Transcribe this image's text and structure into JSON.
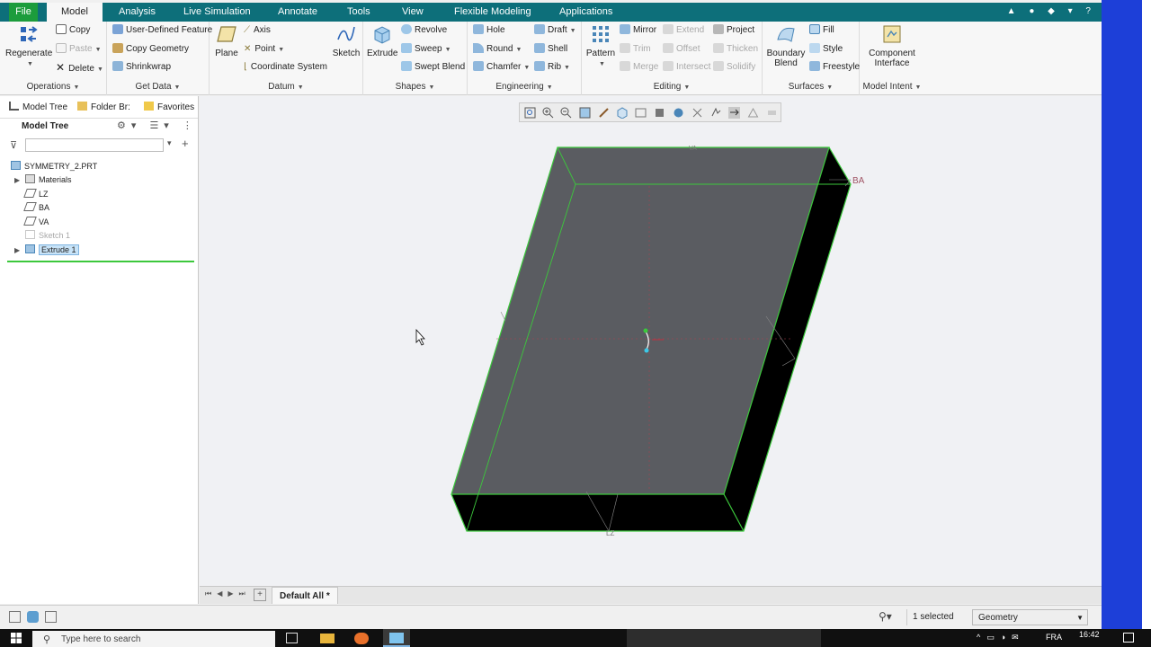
{
  "menu": {
    "tabs": [
      "File",
      "Model",
      "Analysis",
      "Live Simulation",
      "Annotate",
      "Tools",
      "View",
      "Flexible Modeling",
      "Applications"
    ],
    "active": "Model"
  },
  "ribbon": {
    "operations": {
      "regenerate": "Regenerate",
      "copy": "Copy",
      "paste": "Paste",
      "delete": "Delete",
      "label": "Operations"
    },
    "get_data": {
      "udf": "User-Defined Feature",
      "copy_geometry": "Copy Geometry",
      "shrinkwrap": "Shrinkwrap",
      "label": "Get Data"
    },
    "datum": {
      "plane": "Plane",
      "axis": "Axis",
      "point": "Point",
      "csys": "Coordinate System",
      "sketch": "Sketch",
      "label": "Datum"
    },
    "shapes": {
      "extrude": "Extrude",
      "revolve": "Revolve",
      "sweep": "Sweep",
      "swept_blend": "Swept Blend",
      "label": "Shapes"
    },
    "engineering": {
      "hole": "Hole",
      "round": "Round",
      "chamfer": "Chamfer",
      "draft": "Draft",
      "shell": "Shell",
      "rib": "Rib",
      "label": "Engineering"
    },
    "editing": {
      "pattern": "Pattern",
      "mirror": "Mirror",
      "trim": "Trim",
      "merge": "Merge",
      "extend": "Extend",
      "offset": "Offset",
      "intersect": "Intersect",
      "project": "Project",
      "thicken": "Thicken",
      "solidify": "Solidify",
      "label": "Editing"
    },
    "surfaces": {
      "boundary_blend": "Boundary Blend",
      "fill": "Fill",
      "style": "Style",
      "freestyle": "Freestyle",
      "label": "Surfaces"
    },
    "model_intent": {
      "component_interface": "Component Interface",
      "label": "Model Intent"
    }
  },
  "panel": {
    "tabs": [
      "Model Tree",
      "Folder Br:",
      "Favorites"
    ],
    "header": "Model Tree",
    "search_placeholder": "",
    "tree": [
      {
        "label": "SYMMETRY_2.PRT",
        "icon": "part-icon"
      },
      {
        "label": "Materials",
        "icon": "materials-icon"
      },
      {
        "label": "LZ",
        "icon": "datum-plane-icon"
      },
      {
        "label": "BA",
        "icon": "datum-plane-icon"
      },
      {
        "label": "VA",
        "icon": "datum-plane-icon"
      },
      {
        "label": "Sketch 1",
        "icon": "sketch-icon"
      },
      {
        "label": "Extrude 1",
        "icon": "extrude-icon"
      }
    ]
  },
  "viewport": {
    "plane_label_ba": "BA",
    "plane_label_lz": "LZ",
    "plane_label_va": "VA"
  },
  "bottom": {
    "view_tab": "Default All *"
  },
  "status": {
    "selected": "1 selected",
    "filter": "Geometry"
  },
  "taskbar": {
    "search_placeholder": "Type here to search",
    "lang": "FRA",
    "time": "16:42"
  },
  "colors": {
    "menu_bg": "#0d6f7a",
    "file_tab": "#1c9c3c",
    "model_top": "#5a5c61",
    "model_side": "#000000",
    "edge_highlight": "#3cc83c"
  }
}
